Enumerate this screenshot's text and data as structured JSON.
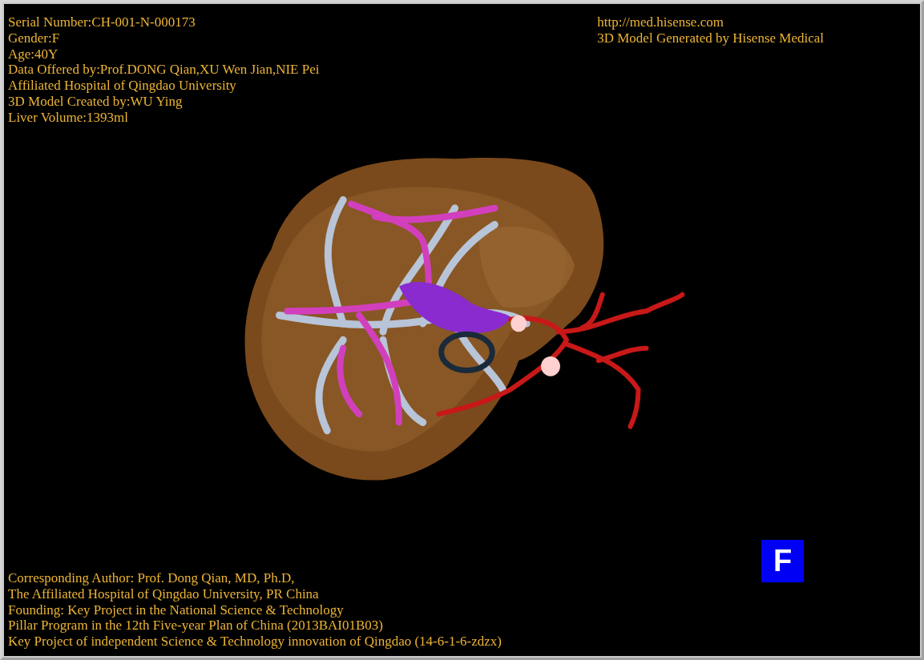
{
  "patient_info": [
    "Serial Number:CH-001-N-000173",
    "Gender:F",
    "Age:40Y",
    "Data Offered by:Prof.DONG Qian,XU Wen Jian,NIE Pei",
    "Affiliated Hospital of Qingdao University",
    "3D Model Created by:WU Ying",
    "Liver Volume:1393ml"
  ],
  "source_info": [
    "http://med.hisense.com",
    "3D Model Generated by Hisense Medical"
  ],
  "credits": [
    "Corresponding Author: Prof. Dong Qian, MD, Ph.D,",
    "The Affiliated Hospital of Qingdao University, PR China",
    "Founding: Key Project in the National Science & Technology",
    "Pillar Program in the 12th Five-year Plan of China (2013BAI01B03)",
    "Key Project of independent Science & Technology innovation of Qingdao (14-6-1-6-zdzx)"
  ],
  "orientation_marker": "F"
}
